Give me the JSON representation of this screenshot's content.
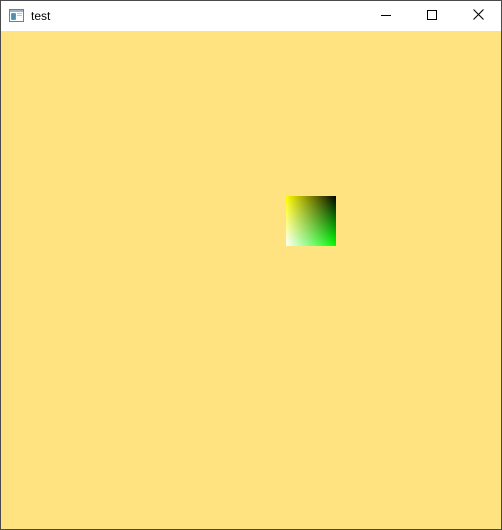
{
  "window": {
    "title": "test"
  },
  "icons": {
    "app": "app-window-icon",
    "minimize": "minimize-icon",
    "maximize": "maximize-icon",
    "close": "close-icon"
  },
  "colors": {
    "client_background": "#ffe381",
    "square_top_left": "#ffff00",
    "square_top_right": "#000000",
    "square_bottom_left": "#ffffff",
    "square_bottom_right": "#00ff00"
  }
}
